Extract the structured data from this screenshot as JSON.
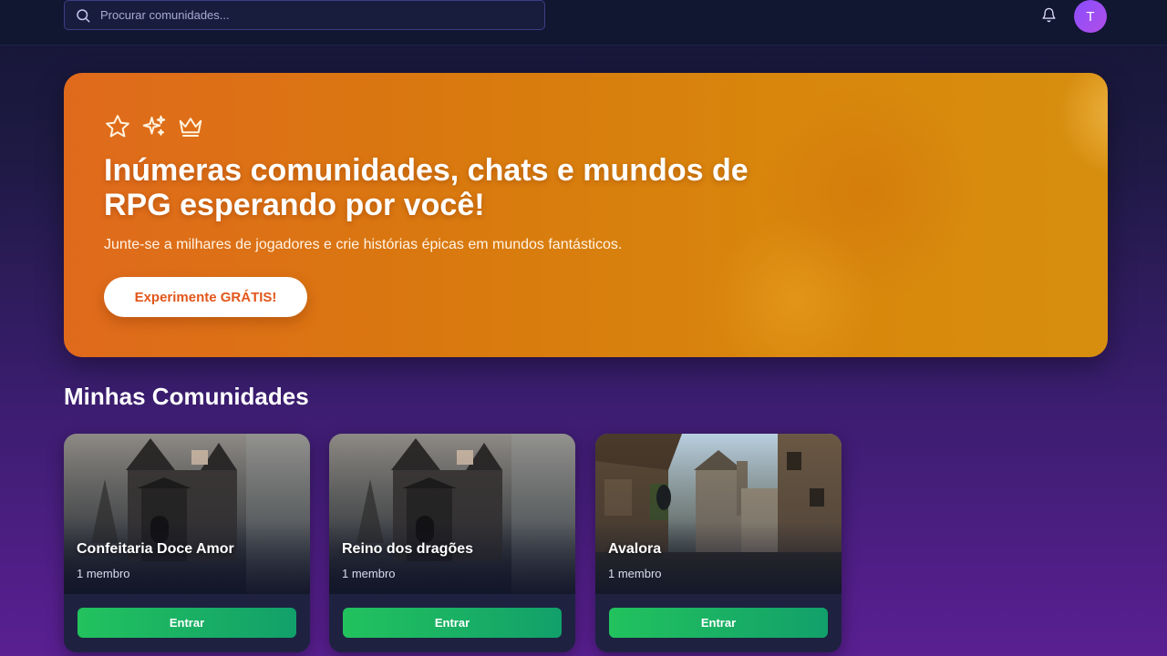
{
  "header": {
    "search_placeholder": "Procurar comunidades...",
    "search_icon": "search-icon",
    "notification_icon": "bell-icon",
    "avatar_initial": "T"
  },
  "hero": {
    "icons": [
      "star-icon",
      "sparkles-icon",
      "crown-icon"
    ],
    "title": "Inúmeras comunidades, chats e mundos de RPG esperando por você!",
    "subtitle": "Junte-se a milhares de jogadores e crie histórias épicas em mundos fantásticos.",
    "cta_label": "Experimente GRÁTIS!",
    "cta_color": "#e2561a"
  },
  "section": {
    "title": "Minhas Comunidades"
  },
  "communities": [
    {
      "name": "Confeitaria Doce Amor",
      "members": "1 membro",
      "enter_label": "Entrar",
      "image": "castle-image"
    },
    {
      "name": "Reino dos dragões",
      "members": "1 membro",
      "enter_label": "Entrar",
      "image": "castle-image"
    },
    {
      "name": "Avalora",
      "members": "1 membro",
      "enter_label": "Entrar",
      "image": "village-image"
    }
  ],
  "colors": {
    "accent_orange": "#e06a1c",
    "accent_green": "#22c25e",
    "avatar_purple": "#8a4dff"
  }
}
